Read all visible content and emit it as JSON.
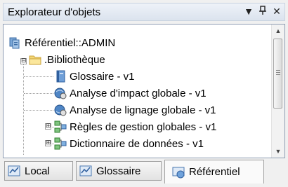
{
  "panel": {
    "title": "Explorateur d'objets",
    "controls": [
      "▼",
      "ᛘ",
      "✕"
    ]
  },
  "tree": {
    "items": [
      {
        "label": "Référentiel::ADMIN",
        "icon": "repository-icon"
      },
      {
        "label": ".Bibliothèque",
        "icon": "folder-icon",
        "expander": "⊟"
      },
      {
        "label": "Glossaire - v1",
        "icon": "glossary-icon"
      },
      {
        "label": "Analyse d'impact globale - v1",
        "icon": "impact-analysis-icon"
      },
      {
        "label": "Analyse de lignage globale - v1",
        "icon": "lineage-analysis-icon"
      },
      {
        "label": "Règles de gestion globales - v1",
        "icon": "rules-icon",
        "expander": "⊞"
      },
      {
        "label": "Dictionnaire de données - v1",
        "icon": "dictionary-icon",
        "expander": "⊞"
      }
    ]
  },
  "tabs": [
    {
      "label": "Local",
      "icon": "local-icon",
      "active": false
    },
    {
      "label": "Glossaire",
      "icon": "glossary-tab-icon",
      "active": false
    },
    {
      "label": "Référentiel",
      "icon": "repository-tab-icon",
      "active": true
    }
  ]
}
